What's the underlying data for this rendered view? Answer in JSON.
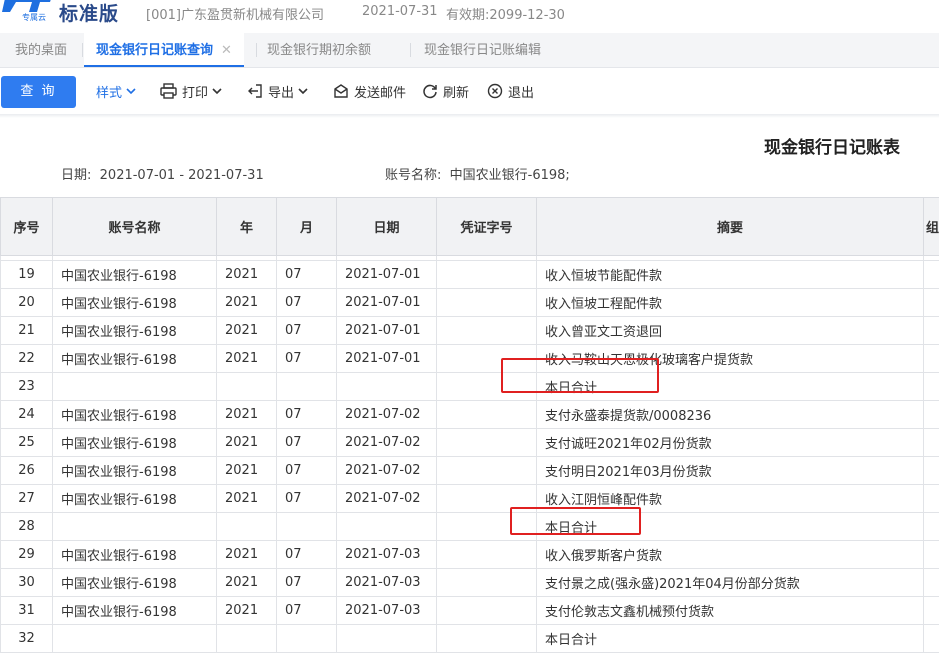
{
  "header": {
    "edition": "标准版",
    "logo_text": "专属云",
    "company": "[001]广东盈贯新机械有限公司",
    "date": "2021-07-31",
    "validity": "有效期:2099-12-30"
  },
  "tabs": [
    {
      "label": "我的桌面",
      "active": false
    },
    {
      "label": "现金银行日记账查询",
      "active": true,
      "close": "✕"
    },
    {
      "label": "现金银行期初余额",
      "active": false
    },
    {
      "label": "现金银行日记账编辑",
      "active": false
    }
  ],
  "toolbar": {
    "query_label": "查 询",
    "style_label": "样式",
    "print_label": "打印",
    "export_label": "导出",
    "email_label": "发送邮件",
    "refresh_label": "刷新",
    "exit_label": "退出"
  },
  "report": {
    "title": "现金银行日记账表",
    "date_label": "日期:",
    "date_range": "2021-07-01 - 2021-07-31",
    "account_label": "账号名称:",
    "account_value": "中国农业银行-6198;"
  },
  "table": {
    "columns": [
      "序号",
      "账号名称",
      "年",
      "月",
      "日期",
      "凭证字号",
      "摘要",
      "组"
    ],
    "rows": [
      [
        "19",
        "中国农业银行-6198",
        "2021",
        "07",
        "2021-07-01",
        "",
        "收入恒坡节能配件款"
      ],
      [
        "20",
        "中国农业银行-6198",
        "2021",
        "07",
        "2021-07-01",
        "",
        "收入恒坡工程配件款"
      ],
      [
        "21",
        "中国农业银行-6198",
        "2021",
        "07",
        "2021-07-01",
        "",
        "收入曾亚文工资退回"
      ],
      [
        "22",
        "中国农业银行-6198",
        "2021",
        "07",
        "2021-07-01",
        "",
        "收入马鞍山天恩极化玻璃客户提货款"
      ],
      [
        "23",
        "",
        "",
        "",
        "",
        "",
        "本日合计"
      ],
      [
        "24",
        "中国农业银行-6198",
        "2021",
        "07",
        "2021-07-02",
        "",
        "支付永盛泰提货款/0008236"
      ],
      [
        "25",
        "中国农业银行-6198",
        "2021",
        "07",
        "2021-07-02",
        "",
        "支付诚旺2021年02月份货款"
      ],
      [
        "26",
        "中国农业银行-6198",
        "2021",
        "07",
        "2021-07-02",
        "",
        "支付明日2021年03月份货款"
      ],
      [
        "27",
        "中国农业银行-6198",
        "2021",
        "07",
        "2021-07-02",
        "",
        "收入江阴恒峰配件款"
      ],
      [
        "28",
        "",
        "",
        "",
        "",
        "",
        "本日合计"
      ],
      [
        "29",
        "中国农业银行-6198",
        "2021",
        "07",
        "2021-07-03",
        "",
        "收入俄罗斯客户货款"
      ],
      [
        "30",
        "中国农业银行-6198",
        "2021",
        "07",
        "2021-07-03",
        "",
        "支付景之成(强永盛)2021年04月份部分货款"
      ],
      [
        "31",
        "中国农业银行-6198",
        "2021",
        "07",
        "2021-07-03",
        "",
        "支付伦敦志文鑫机械预付货款"
      ],
      [
        "32",
        "",
        "",
        "",
        "",
        "",
        "本日合计"
      ]
    ]
  },
  "colors": {
    "accent": "#2f7cf0",
    "highlight": "#e02020"
  }
}
